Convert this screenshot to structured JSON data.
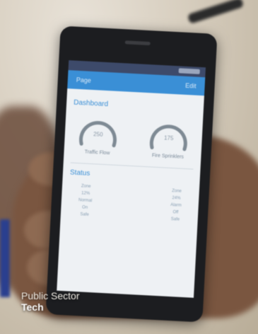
{
  "screen": {
    "appbar": {
      "left_label": "Page",
      "right_label": "Edit"
    },
    "section_1": "Dashboard",
    "gauges": [
      {
        "value": "250",
        "label": "Traffic Flow"
      },
      {
        "value": "175",
        "label": "Fire Sprinklers"
      }
    ],
    "section_2": "Status",
    "columns": [
      [
        "Zone",
        "12%",
        "Normal",
        "On",
        "Safe"
      ],
      [
        "Zone",
        "24%",
        "Alarm",
        "Off",
        "Safe"
      ]
    ]
  },
  "caption": {
    "line1": "Public Sector",
    "line2": "Tech"
  },
  "colors": {
    "appbar": "#3a8fd6",
    "gauge_arc": "#7e8a94"
  }
}
